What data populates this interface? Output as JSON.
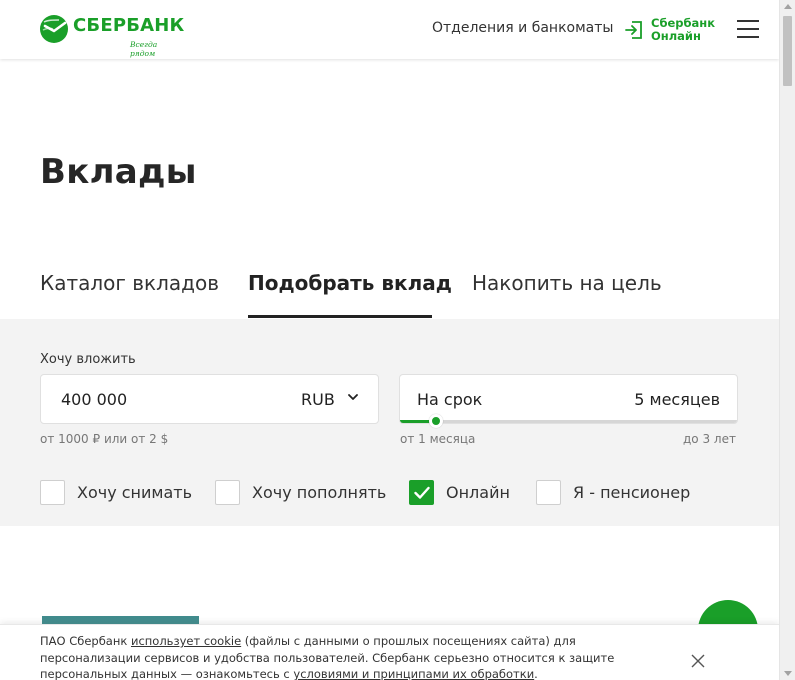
{
  "header": {
    "logo_text": "СБЕРБАНК",
    "logo_tagline": "Всегда рядом",
    "branches_link": "Отделения и банкоматы",
    "online_line1": "Сбербанк",
    "online_line2": "Онлайн",
    "icons": [
      "sberbank-logo-icon",
      "login-icon",
      "menu-icon"
    ]
  },
  "page": {
    "title": "Вклады"
  },
  "tabs": [
    {
      "label": "Каталог вкладов",
      "active": false
    },
    {
      "label": "Подобрать вклад",
      "active": true
    },
    {
      "label": "Накопить на цель",
      "active": false
    }
  ],
  "filter": {
    "invest_label": "Хочу вложить",
    "amount_value": "400 000",
    "currency": "RUB",
    "amount_hint": "от 1000 ₽ или от 2 $",
    "term_label": "На срок",
    "term_value": "5 месяцев",
    "term_level": 0.11,
    "term_min": "от 1 месяца",
    "term_max": "до 3 лет",
    "options": [
      {
        "label": "Хочу снимать",
        "checked": false
      },
      {
        "label": "Хочу пополнять",
        "checked": false
      },
      {
        "label": "Онлайн",
        "checked": true
      },
      {
        "label": "Я - пенсионер",
        "checked": false
      }
    ]
  },
  "cookie": {
    "part1": "ПАО Сбербанк ",
    "link1": "использует cookie",
    "part2": " (файлы с данными о прошлых посещениях сайта) для персонализации сервисов и удобства пользователей. Сбербанк серьезно относится к защите персональных данных — ознакомьтесь с ",
    "link2": "условиями и принципами их обработки",
    "part3": "."
  },
  "colors": {
    "brand_green": "#1a9f29",
    "panel_bg": "#f3f3f3",
    "text_dark": "#222222"
  }
}
